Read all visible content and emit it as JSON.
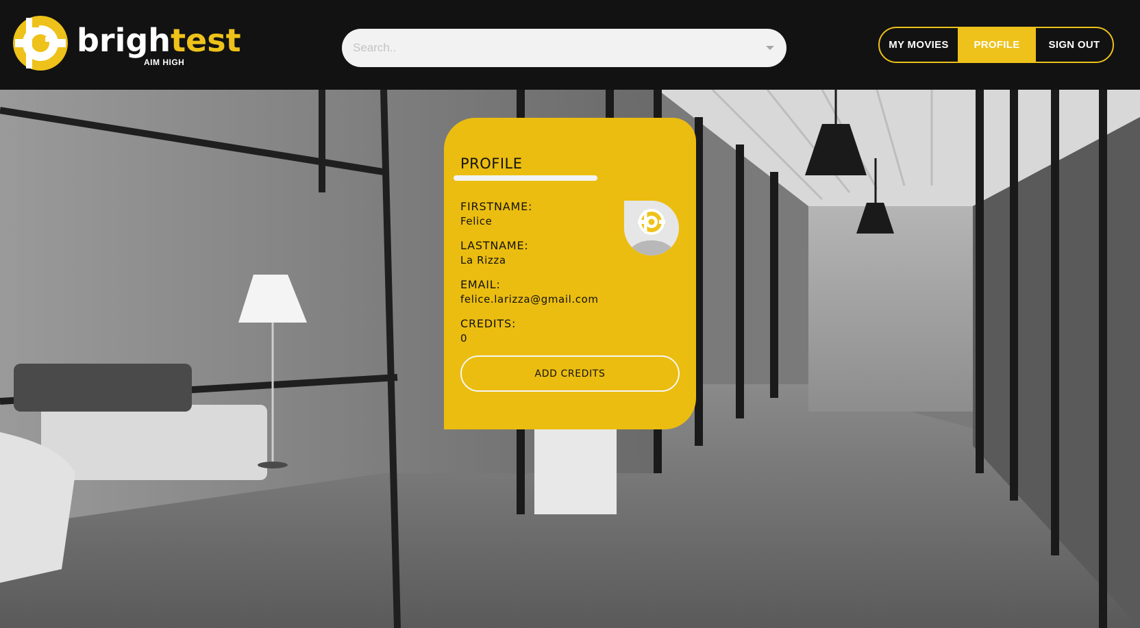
{
  "header": {
    "logo": {
      "word_part1": "brigh",
      "word_part2": "test",
      "tagline": "AIM HIGH",
      "icon": "brightest-logo-icon"
    },
    "search": {
      "placeholder": "Search..",
      "value": "",
      "icon": "caret-down-icon"
    },
    "nav": {
      "my_movies": "MY MOVIES",
      "profile": "PROFILE",
      "sign_out": "SIGN OUT",
      "active": "profile"
    }
  },
  "profile": {
    "title": "PROFILE",
    "avatar_icon": "user-avatar-icon",
    "firstname_label": "FIRSTNAME:",
    "firstname": "Felice",
    "lastname_label": "LASTNAME:",
    "lastname": "La Rizza",
    "email_label": "EMAIL:",
    "email": "felice.larizza@gmail.com",
    "credits_label": "CREDITS:",
    "credits": "0",
    "add_credits_label": "ADD CREDITS"
  },
  "theme": {
    "accent": "#ebbd10",
    "header_bg": "#121212",
    "light": "#f2f2f2"
  }
}
